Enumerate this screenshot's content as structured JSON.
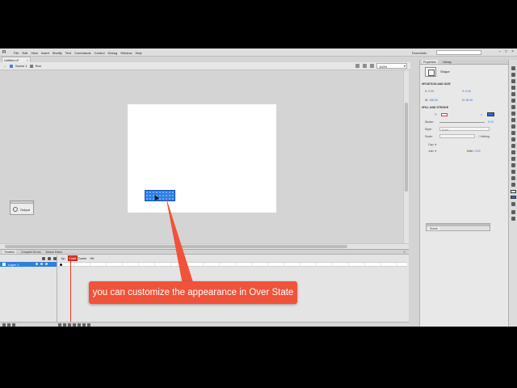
{
  "app": {
    "logo": "Fl"
  },
  "menu": [
    "File",
    "Edit",
    "View",
    "Insert",
    "Modify",
    "Text",
    "Commands",
    "Control",
    "Debug",
    "Window",
    "Help"
  ],
  "workspace": "Essentials",
  "window_controls": {
    "minimize": "–",
    "maximize": "□",
    "close": "×"
  },
  "doc_tab": {
    "title": "Untitled-4*",
    "close": "×"
  },
  "breadcrumb": {
    "scene": "Scene 1",
    "symbol": "Run"
  },
  "zoom": {
    "value": "100%"
  },
  "output_panel": {
    "label": "Output"
  },
  "timeline": {
    "tabs": [
      "Timeline",
      "Compiler Errors",
      "Motion Editor"
    ],
    "frame_labels": [
      "Up",
      "Over",
      "Down",
      "Hit"
    ],
    "active_frame": "Over",
    "layer_name": "Layer 1"
  },
  "callout": {
    "text": "you can customize the appearance in Over State"
  },
  "properties": {
    "tabs": [
      "Properties",
      "Library"
    ],
    "object_type": "Shape",
    "sections": {
      "position": "POSITION AND SIZE",
      "fill": "FILL AND STROKE"
    },
    "position": {
      "x_label": "X:",
      "x": "0.00",
      "y_label": "Y:",
      "y": "0.00",
      "w_label": "W:",
      "w": "136.00",
      "h_label": "H:",
      "h": "90.00"
    },
    "stroke_label": "Stroke:",
    "stroke_value": "0.10",
    "style_label": "Style:",
    "style_value": "Solid",
    "scale_label": "Scale:",
    "hinting_label": "Hinting",
    "cap_label": "Cap:",
    "join_label": "Join:",
    "miter_label": "Miter:",
    "miter_value": "3.00",
    "fill_color": "#1f6fd8"
  },
  "mini_panel": {
    "tab": "Scene"
  }
}
